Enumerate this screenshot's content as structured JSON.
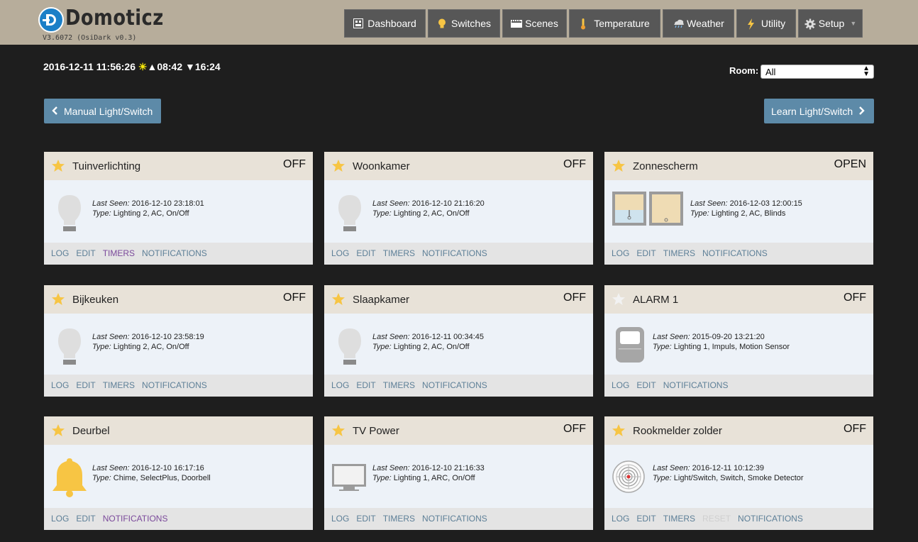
{
  "app": {
    "name": "Domoticz",
    "version": "V3.6072 (OsiDark v0.3)"
  },
  "nav": [
    {
      "label": "Dashboard",
      "icon": "dashboard-icon"
    },
    {
      "label": "Switches",
      "icon": "lightbulb-icon"
    },
    {
      "label": "Scenes",
      "icon": "clapperboard-icon"
    },
    {
      "label": "Temperature",
      "icon": "thermometer-icon"
    },
    {
      "label": "Weather",
      "icon": "weather-icon"
    },
    {
      "label": "Utility",
      "icon": "lightning-icon"
    },
    {
      "label": "Setup",
      "icon": "gear-icon"
    }
  ],
  "info": {
    "datetime": "2016-12-11 11:56:26",
    "sunrise": "08:42",
    "sunset": "16:24",
    "room_label": "Room:",
    "room_value": "All"
  },
  "buttons": {
    "manual": "Manual Light/Switch",
    "learn": "Learn Light/Switch"
  },
  "labels": {
    "last_seen": "Last Seen:",
    "type": "Type:"
  },
  "devices": [
    {
      "name": "Tuinverlichting",
      "status": "OFF",
      "favorite": true,
      "last_seen": "2016-12-10 23:18:01",
      "type": "Lighting 2, AC, On/Off",
      "icon": "lightbulb-icon",
      "links": [
        {
          "label": "LOG"
        },
        {
          "label": "EDIT"
        },
        {
          "label": "TIMERS",
          "style": "purple"
        },
        {
          "label": "NOTIFICATIONS"
        }
      ]
    },
    {
      "name": "Woonkamer",
      "status": "OFF",
      "favorite": true,
      "last_seen": "2016-12-10 21:16:20",
      "type": "Lighting 2, AC, On/Off",
      "icon": "lightbulb-icon",
      "links": [
        {
          "label": "LOG"
        },
        {
          "label": "EDIT"
        },
        {
          "label": "TIMERS"
        },
        {
          "label": "NOTIFICATIONS"
        }
      ]
    },
    {
      "name": "Zonnescherm",
      "status": "OPEN",
      "favorite": true,
      "last_seen": "2016-12-03 12:00:15",
      "type": "Lighting 2, AC, Blinds",
      "icon": "blinds-icon",
      "links": [
        {
          "label": "LOG"
        },
        {
          "label": "EDIT"
        },
        {
          "label": "TIMERS"
        },
        {
          "label": "NOTIFICATIONS"
        }
      ]
    },
    {
      "name": "Bijkeuken",
      "status": "OFF",
      "favorite": true,
      "last_seen": "2016-12-10 23:58:19",
      "type": "Lighting 2, AC, On/Off",
      "icon": "lightbulb-icon",
      "links": [
        {
          "label": "LOG"
        },
        {
          "label": "EDIT"
        },
        {
          "label": "TIMERS"
        },
        {
          "label": "NOTIFICATIONS"
        }
      ]
    },
    {
      "name": "Slaapkamer",
      "status": "OFF",
      "favorite": true,
      "last_seen": "2016-12-11 00:34:45",
      "type": "Lighting 2, AC, On/Off",
      "icon": "lightbulb-icon",
      "links": [
        {
          "label": "LOG"
        },
        {
          "label": "EDIT"
        },
        {
          "label": "TIMERS"
        },
        {
          "label": "NOTIFICATIONS"
        }
      ]
    },
    {
      "name": "ALARM 1",
      "status": "OFF",
      "favorite": false,
      "last_seen": "2015-09-20 13:21:20",
      "type": "Lighting 1, Impuls, Motion Sensor",
      "icon": "motion-sensor-icon",
      "links": [
        {
          "label": "LOG"
        },
        {
          "label": "EDIT"
        },
        {
          "label": "NOTIFICATIONS"
        }
      ]
    },
    {
      "name": "Deurbel",
      "status": "",
      "favorite": true,
      "last_seen": "2016-12-10 16:17:16",
      "type": "Chime, SelectPlus, Doorbell",
      "icon": "bell-icon",
      "links": [
        {
          "label": "LOG"
        },
        {
          "label": "EDIT"
        },
        {
          "label": "NOTIFICATIONS",
          "style": "purple"
        }
      ]
    },
    {
      "name": "TV Power",
      "status": "OFF",
      "favorite": true,
      "last_seen": "2016-12-10 21:16:33",
      "type": "Lighting 1, ARC, On/Off",
      "icon": "tv-icon",
      "links": [
        {
          "label": "LOG"
        },
        {
          "label": "EDIT"
        },
        {
          "label": "TIMERS"
        },
        {
          "label": "NOTIFICATIONS"
        }
      ]
    },
    {
      "name": "Rookmelder zolder",
      "status": "OFF",
      "favorite": true,
      "last_seen": "2016-12-11 10:12:39",
      "type": "Light/Switch, Switch, Smoke Detector",
      "icon": "smoke-detector-icon",
      "links": [
        {
          "label": "LOG"
        },
        {
          "label": "EDIT"
        },
        {
          "label": "TIMERS"
        },
        {
          "label": "RESET",
          "style": "dim"
        },
        {
          "label": "NOTIFICATIONS"
        }
      ]
    }
  ]
}
